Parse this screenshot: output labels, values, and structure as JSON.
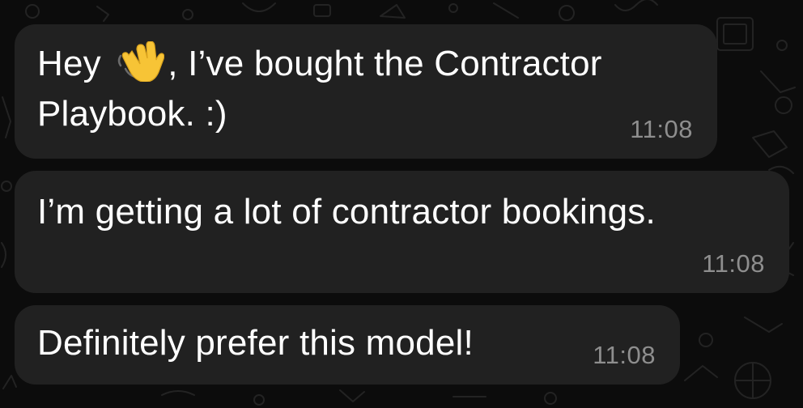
{
  "messages": [
    {
      "line1_before_emoji": "Hey ",
      "emoji_name": "waving-hand-icon",
      "line1_after_emoji": ", I’ve bought the Contractor",
      "line2": "Playbook. :)",
      "time": "11:08"
    },
    {
      "text": "I’m getting a lot of contractor bookings.",
      "time": "11:08"
    },
    {
      "text": "Definitely prefer this model!",
      "time": "11:08"
    }
  ],
  "colors": {
    "background": "#0c0c0c",
    "bubble": "#212121",
    "text": "#ffffff",
    "timestamp": "#8e8e8e",
    "emoji": "#f7c436"
  }
}
